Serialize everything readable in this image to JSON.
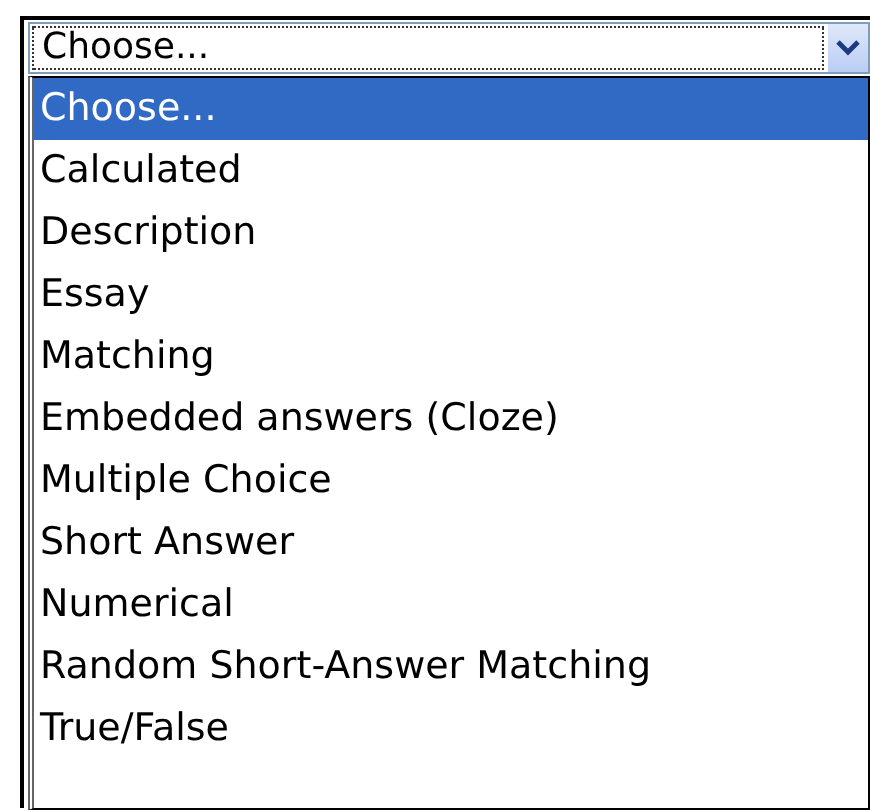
{
  "select": {
    "value": "Choose...",
    "focused": true
  },
  "options": [
    {
      "label": "Choose...",
      "selected": true
    },
    {
      "label": "Calculated",
      "selected": false
    },
    {
      "label": "Description",
      "selected": false
    },
    {
      "label": "Essay",
      "selected": false
    },
    {
      "label": "Matching",
      "selected": false
    },
    {
      "label": "Embedded answers (Cloze)",
      "selected": false
    },
    {
      "label": "Multiple Choice",
      "selected": false
    },
    {
      "label": "Short Answer",
      "selected": false
    },
    {
      "label": "Numerical",
      "selected": false
    },
    {
      "label": "Random Short-Answer Matching",
      "selected": false
    },
    {
      "label": "True/False",
      "selected": false
    }
  ]
}
